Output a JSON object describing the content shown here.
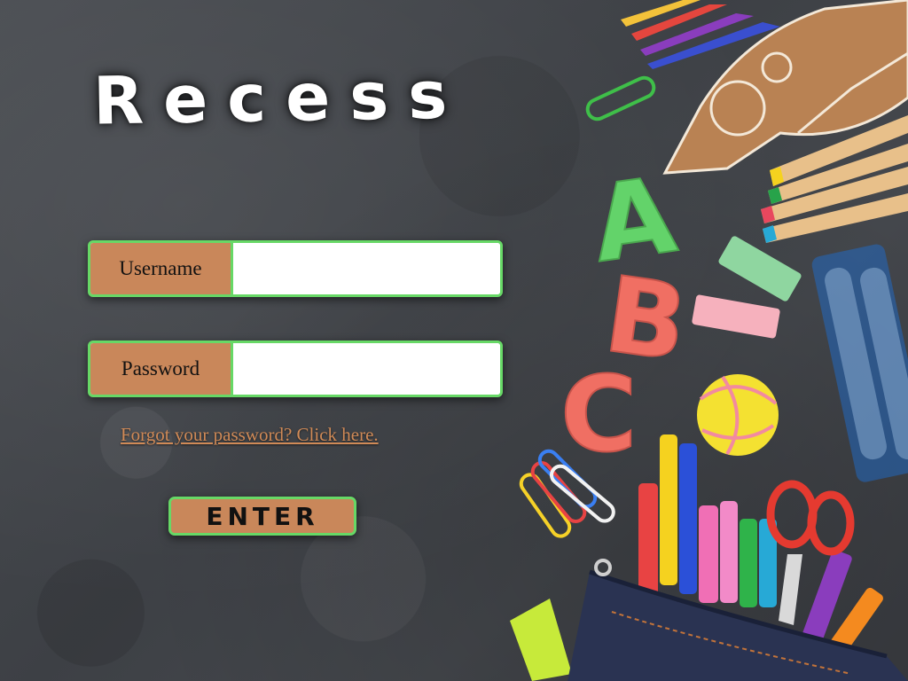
{
  "app": {
    "title": "Recess"
  },
  "login": {
    "username_label": "Username",
    "username_value": "",
    "password_label": "Password",
    "password_value": "",
    "forgot_link": "Forgot your password? Click here.",
    "enter_button": "ENTER"
  },
  "decor_letters": [
    "A",
    "B",
    "C"
  ],
  "colors": {
    "field_border": "#67d866",
    "label_bg": "#c9875a",
    "link": "#d08a57",
    "chalkboard": "#43464b"
  }
}
